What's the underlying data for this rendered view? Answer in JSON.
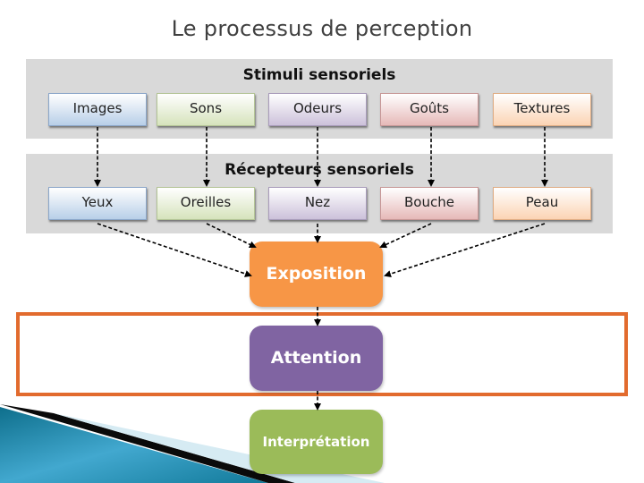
{
  "title": "Le processus de perception",
  "stimuli": {
    "heading": "Stimuli sensoriels",
    "items": [
      "Images",
      "Sons",
      "Odeurs",
      "Goûts",
      "Textures"
    ]
  },
  "receptors": {
    "heading": "Récepteurs sensoriels",
    "items": [
      "Yeux",
      "Oreilles",
      "Nez",
      "Bouche",
      "Peau"
    ]
  },
  "steps": [
    {
      "label": "Exposition",
      "color": "#f79646"
    },
    {
      "label": "Attention",
      "color": "#8064a2"
    },
    {
      "label": "Interprétation",
      "color": "#9bbb59"
    }
  ],
  "highlight_color": "#e26b2e"
}
